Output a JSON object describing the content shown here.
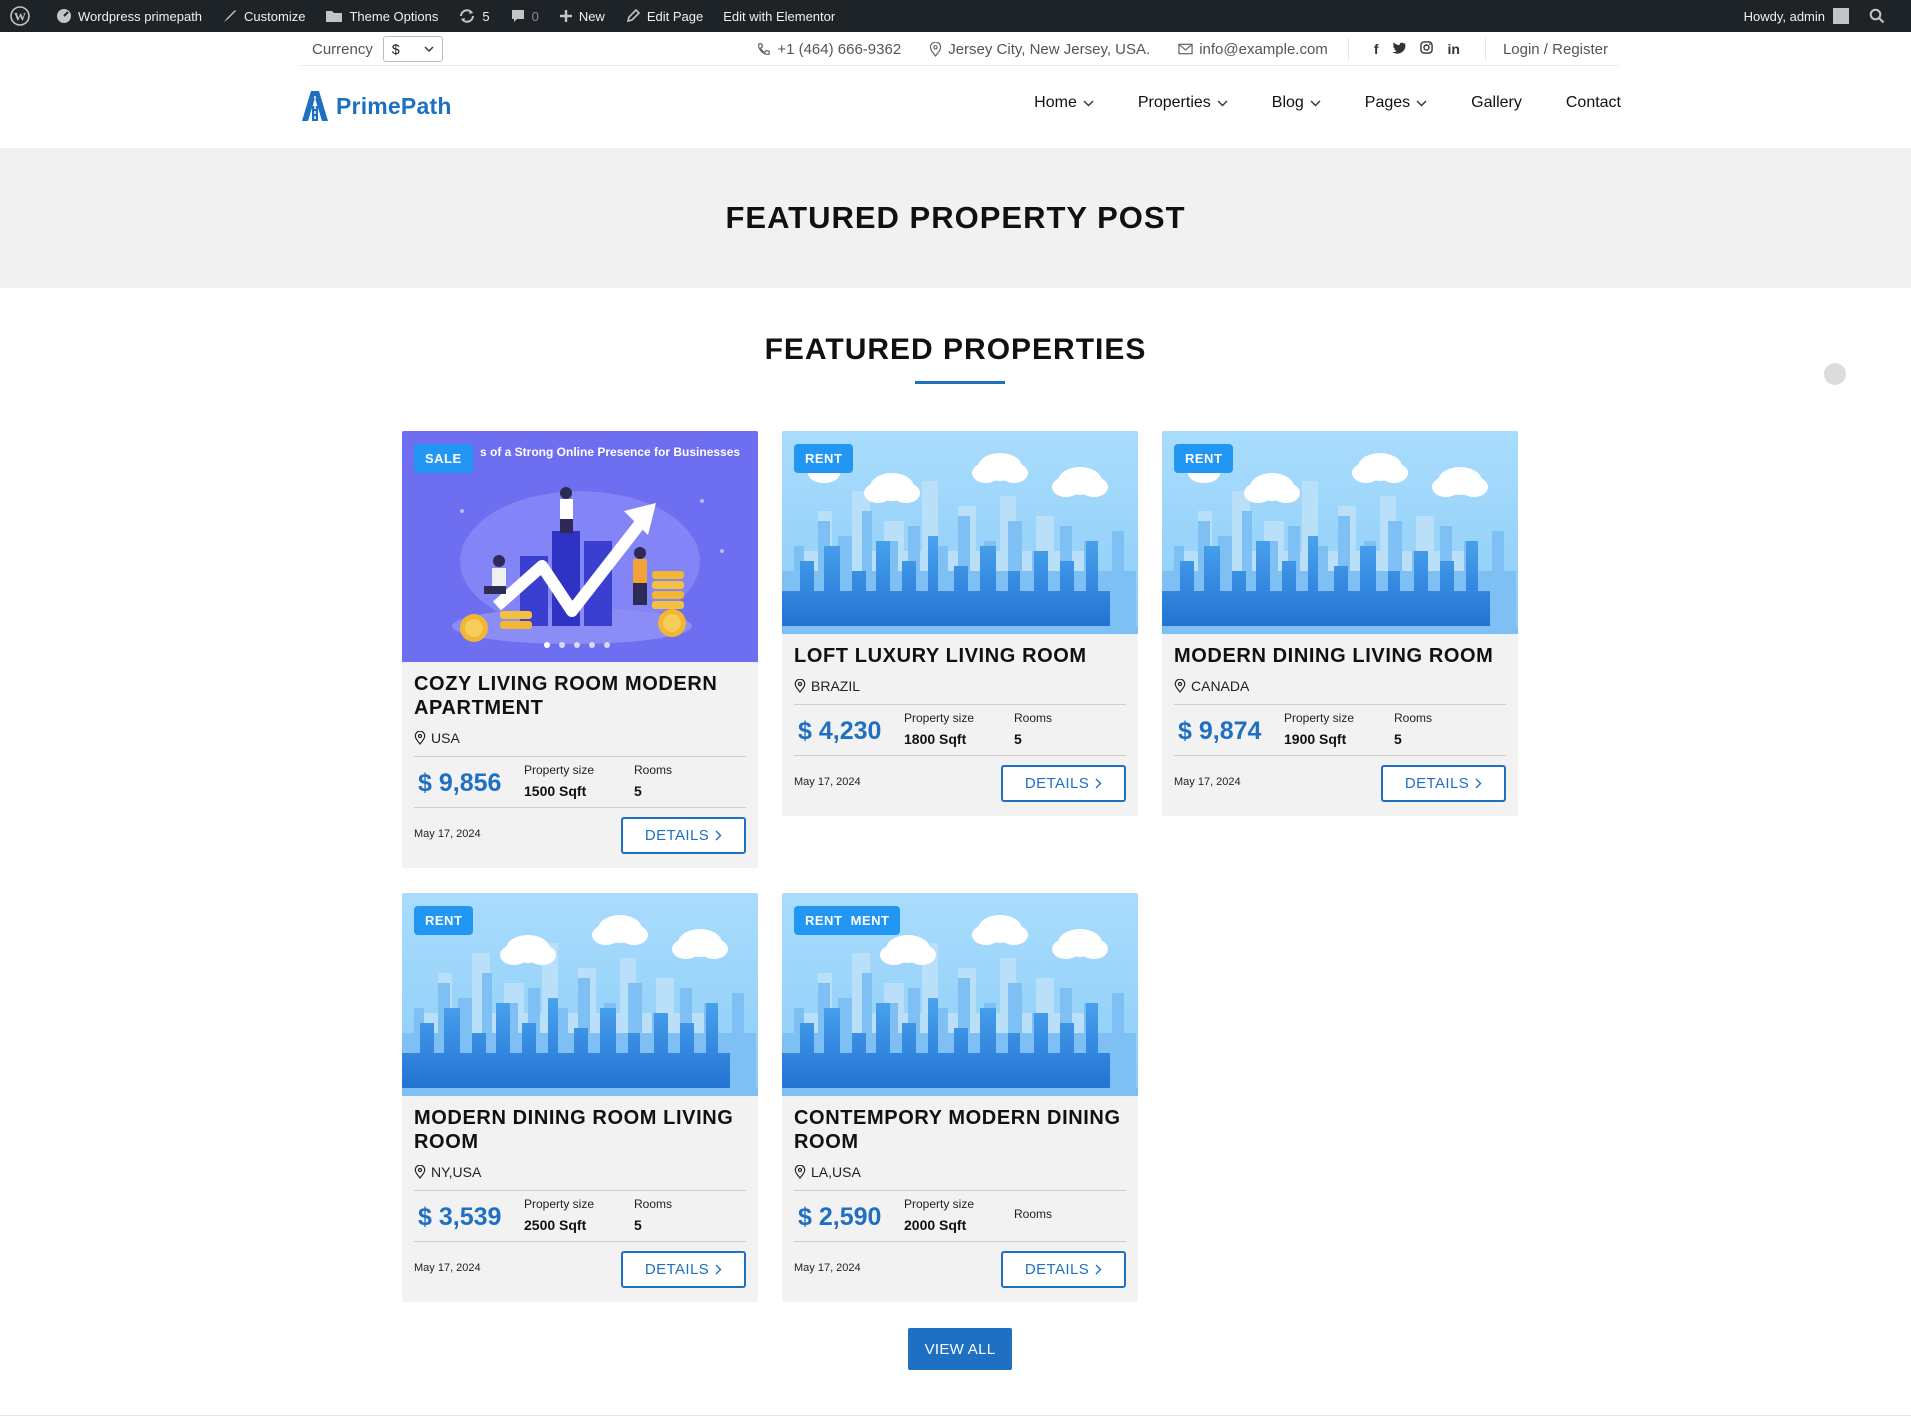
{
  "adminbar": {
    "site": "Wordpress primepath",
    "customize": "Customize",
    "theme_options": "Theme Options",
    "updates": "5",
    "comments": "0",
    "new": "New",
    "edit_page": "Edit Page",
    "edit_elementor": "Edit with Elementor",
    "howdy": "Howdy, admin"
  },
  "topbar": {
    "currency_label": "Currency",
    "currency_value": "$",
    "phone": "+1 (464) 666-9362",
    "address": "Jersey City, New Jersey, USA.",
    "email": "info@example.com",
    "social": [
      "f",
      "t",
      "◎",
      "in"
    ],
    "login": "Login / Register"
  },
  "header": {
    "logo": "PrimePath",
    "nav": [
      {
        "label": "Home",
        "dropdown": true
      },
      {
        "label": "Properties",
        "dropdown": true
      },
      {
        "label": "Blog",
        "dropdown": true
      },
      {
        "label": "Pages",
        "dropdown": true
      },
      {
        "label": "Gallery",
        "dropdown": false
      },
      {
        "label": "Contact",
        "dropdown": false
      }
    ]
  },
  "page_title": "FEATURED PROPERTY POST",
  "section_title": "FEATURED PROPERTIES",
  "properties": [
    {
      "badge": "SALE",
      "image_caption": "s of a Strong Online Presence for Businesses",
      "title": "COZY LIVING ROOM MODERN APARTMENT",
      "location": "USA",
      "price": "$ 9,856",
      "size_label": "Property size",
      "size": "1500 Sqft",
      "rooms_label": "Rooms",
      "rooms": "5",
      "date": "May 17, 2024",
      "details": "DETAILS"
    },
    {
      "badge": "RENT",
      "title": "LOFT LUXURY LIVING ROOM",
      "location": "BRAZIL",
      "price": "$ 4,230",
      "size_label": "Property size",
      "size": "1800 Sqft",
      "rooms_label": "Rooms",
      "rooms": "5",
      "date": "May 17, 2024",
      "details": "DETAILS"
    },
    {
      "badge": "RENT",
      "title": "MODERN DINING LIVING ROOM",
      "location": "CANADA",
      "price": "$ 9,874",
      "size_label": "Property size",
      "size": "1900 Sqft",
      "rooms_label": "Rooms",
      "rooms": "5",
      "date": "May 17, 2024",
      "details": "DETAILS"
    },
    {
      "badge": "RENT",
      "title": "MODERN DINING ROOM LIVING ROOM",
      "location": "NY,USA",
      "price": "$ 3,539",
      "size_label": "Property size",
      "size": "2500 Sqft",
      "rooms_label": "Rooms",
      "rooms": "5",
      "date": "May 17, 2024",
      "details": "DETAILS"
    },
    {
      "badge": "RENT  MENT",
      "title": "CONTEMPORY MODERN DINING ROOM",
      "location": "LA,USA",
      "price": "$ 2,590",
      "size_label": "Property size",
      "size": "2000 Sqft",
      "rooms_label": "Rooms",
      "rooms": "",
      "date": "May 17, 2024",
      "details": "DETAILS"
    }
  ],
  "view_all": "VIEW ALL",
  "colors": {
    "accent": "#1f6fc2",
    "badge": "#2196f3",
    "adminbar": "#1d2327"
  }
}
